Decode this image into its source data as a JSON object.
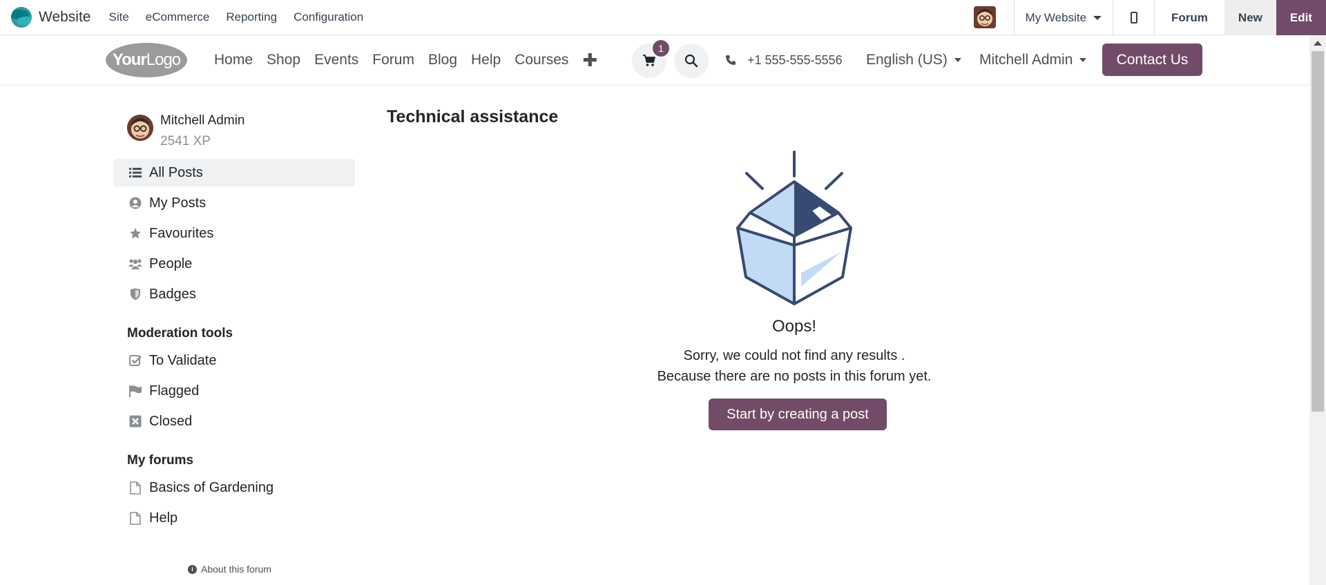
{
  "adminbar": {
    "brand": "Website",
    "menu": [
      "Site",
      "eCommerce",
      "Reporting",
      "Configuration"
    ],
    "website_switcher": "My Website",
    "forum_label": "Forum",
    "new_label": "New",
    "edit_label": "Edit"
  },
  "header": {
    "logo": {
      "main": "Your",
      "sub": "Logo"
    },
    "nav": [
      "Home",
      "Shop",
      "Events",
      "Forum",
      "Blog",
      "Help",
      "Courses"
    ],
    "cart_count": "1",
    "phone": "+1 555-555-5556",
    "language": "English (US)",
    "user": "Mitchell Admin",
    "contact_label": "Contact Us"
  },
  "sidebar": {
    "user_name": "Mitchell Admin",
    "xp": "2541 XP",
    "items": [
      {
        "label": "All Posts",
        "icon": "list-icon",
        "active": true
      },
      {
        "label": "My Posts",
        "icon": "user-circle-icon"
      },
      {
        "label": "Favourites",
        "icon": "star-icon"
      },
      {
        "label": "People",
        "icon": "users-icon"
      },
      {
        "label": "Badges",
        "icon": "shield-icon"
      }
    ],
    "moderation_title": "Moderation tools",
    "moderation": [
      {
        "label": "To Validate",
        "icon": "check-square-icon"
      },
      {
        "label": "Flagged",
        "icon": "flag-icon"
      },
      {
        "label": "Closed",
        "icon": "close-square-icon"
      }
    ],
    "forums_title": "My forums",
    "forums": [
      {
        "label": "Basics of Gardening",
        "icon": "file-icon"
      },
      {
        "label": "Help",
        "icon": "file-icon"
      }
    ],
    "about": "About this forum"
  },
  "main": {
    "title": "Technical assistance",
    "oops": "Oops!",
    "line1": "Sorry, we could not find any results .",
    "line2": "Because there are no posts in this forum yet.",
    "start_label": "Start by creating a post"
  },
  "colors": {
    "brand": "#714b67",
    "illustration_dark": "#374a72",
    "illustration_light": "#c2dbf5"
  }
}
